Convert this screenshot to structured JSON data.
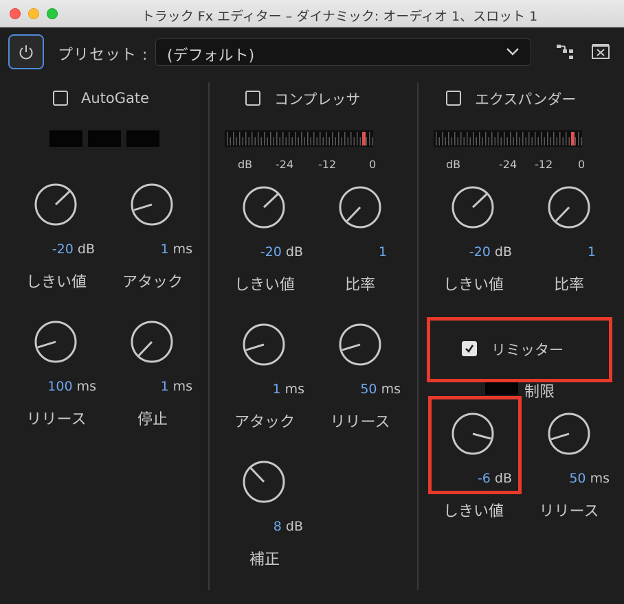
{
  "window": {
    "title": "トラック Fx エディター – ダイナミック: オーディオ 1、スロット 1"
  },
  "toolbar": {
    "preset_label": "プリセット :",
    "preset_value": "(デフォルト)"
  },
  "autogate": {
    "title": "AutoGate",
    "enabled": false,
    "knobs": [
      {
        "value": "-20",
        "unit": "dB",
        "label": "しきい値"
      },
      {
        "value": "1",
        "unit": "ms",
        "label": "アタック"
      },
      {
        "value": "100",
        "unit": "ms",
        "label": "リリース"
      },
      {
        "value": "1",
        "unit": "ms",
        "label": "停止"
      }
    ]
  },
  "compressor": {
    "title": "コンプレッサ",
    "enabled": false,
    "meter_scale": [
      "dB",
      "-24",
      "-12",
      "0"
    ],
    "knobs": [
      {
        "value": "-20",
        "unit": "dB",
        "label": "しきい値"
      },
      {
        "value": "1",
        "unit": "",
        "label": "比率"
      },
      {
        "value": "1",
        "unit": "ms",
        "label": "アタック"
      },
      {
        "value": "50",
        "unit": "ms",
        "label": "リリース"
      },
      {
        "value": "8",
        "unit": "dB",
        "label": "補正"
      }
    ]
  },
  "expander": {
    "title": "エクスパンダー",
    "enabled": false,
    "meter_scale": [
      "dB",
      "-24",
      "-12",
      "0"
    ],
    "knobs": [
      {
        "value": "-20",
        "unit": "dB",
        "label": "しきい値"
      },
      {
        "value": "1",
        "unit": "",
        "label": "比率"
      }
    ]
  },
  "limiter": {
    "title": "リミッター",
    "enabled": true,
    "limit_label": "制限",
    "knobs": [
      {
        "value": "-6",
        "unit": "dB",
        "label": "しきい値"
      },
      {
        "value": "50",
        "unit": "ms",
        "label": "リリース"
      }
    ]
  },
  "colors": {
    "accent_blue": "#6ea8f0",
    "highlight_red": "#e8392b",
    "meter_peak": "#e05050"
  }
}
